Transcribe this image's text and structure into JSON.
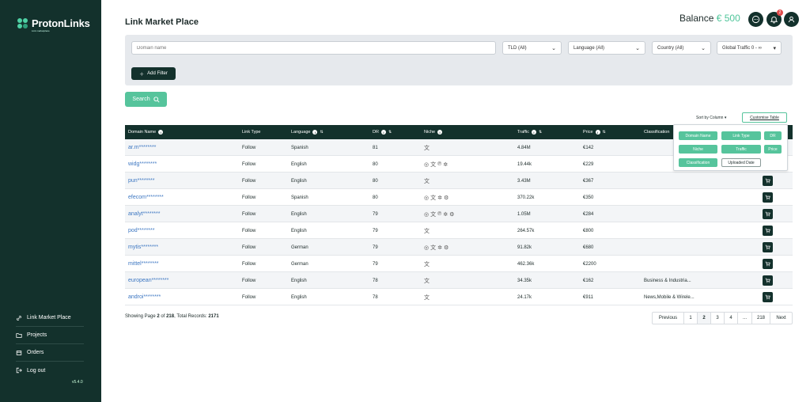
{
  "sidebar": {
    "logo_text": "ProtonLinks",
    "logo_sub": "Link marketplace",
    "items": [
      {
        "label": "Link Market Place",
        "icon": "link-icon"
      },
      {
        "label": "Projects",
        "icon": "folder-icon"
      },
      {
        "label": "Orders",
        "icon": "orders-icon"
      },
      {
        "label": "Log out",
        "icon": "logout-icon"
      }
    ],
    "version": "v5.4.0"
  },
  "header": {
    "title": "Link Market Place",
    "balance_label": "Balance",
    "balance_amount": "€ 500",
    "notification_count": "2"
  },
  "filters": {
    "domain_placeholder": "Domain name",
    "tld": "TLD (All)",
    "language": "Language (All)",
    "country": "Country (All)",
    "traffic": "Global Traffic  0 - ∞",
    "add_filter": "Add Filter",
    "search": "Search"
  },
  "table_controls": {
    "sort_by": "Sort by Column",
    "customise": "Customise Table"
  },
  "columns": {
    "domain": "Domain Name",
    "link_type": "Link Type",
    "language": "Language",
    "dr": "DR",
    "niche": "Niche",
    "traffic": "Traffic",
    "price": "Price",
    "classification": "Classification"
  },
  "rows": [
    {
      "domain": "ar.m********",
      "link_type": "Follow",
      "language": "Spanish",
      "dr": "81",
      "niche": [
        "translate"
      ],
      "traffic": "4.84M",
      "price": "€142",
      "classification": ""
    },
    {
      "domain": "widg********",
      "link_type": "Follow",
      "language": "English",
      "dr": "80",
      "niche": [
        "casino",
        "translate",
        "cbd",
        "sun"
      ],
      "traffic": "19.44k",
      "price": "€229",
      "classification": ""
    },
    {
      "domain": "pun********",
      "link_type": "Follow",
      "language": "English",
      "dr": "80",
      "niche": [
        "translate"
      ],
      "traffic": "3.43M",
      "price": "€367",
      "classification": ""
    },
    {
      "domain": "efecom********",
      "link_type": "Follow",
      "language": "Spanish",
      "dr": "80",
      "niche": [
        "casino",
        "translate",
        "sun",
        "gear"
      ],
      "traffic": "370.22k",
      "price": "€350",
      "classification": ""
    },
    {
      "domain": "analyt********",
      "link_type": "Follow",
      "language": "English",
      "dr": "79",
      "niche": [
        "casino",
        "translate",
        "cbd",
        "sun",
        "gear"
      ],
      "traffic": "1.05M",
      "price": "€284",
      "classification": ""
    },
    {
      "domain": "pod********",
      "link_type": "Follow",
      "language": "English",
      "dr": "79",
      "niche": [
        "translate"
      ],
      "traffic": "264.57k",
      "price": "€800",
      "classification": ""
    },
    {
      "domain": "mytis********",
      "link_type": "Follow",
      "language": "German",
      "dr": "79",
      "niche": [
        "casino",
        "translate",
        "sun",
        "gear"
      ],
      "traffic": "91.82k",
      "price": "€680",
      "classification": ""
    },
    {
      "domain": "mittel********",
      "link_type": "Follow",
      "language": "German",
      "dr": "79",
      "niche": [
        "translate"
      ],
      "traffic": "462.36k",
      "price": "€2200",
      "classification": ""
    },
    {
      "domain": "european********",
      "link_type": "Follow",
      "language": "English",
      "dr": "78",
      "niche": [
        "translate"
      ],
      "traffic": "34.35k",
      "price": "€162",
      "classification": "Business & Industria..."
    },
    {
      "domain": "androi********",
      "link_type": "Follow",
      "language": "English",
      "dr": "78",
      "niche": [
        "translate"
      ],
      "traffic": "24.17k",
      "price": "€911",
      "classification": "News,Mobile & Wirele..."
    }
  ],
  "customise_popup": {
    "chips": [
      {
        "label": "Domain Name",
        "on": true
      },
      {
        "label": "Link Type",
        "on": true
      },
      {
        "label": "DR",
        "on": true
      },
      {
        "label": "Niche",
        "on": true
      },
      {
        "label": "Traffic",
        "on": true
      },
      {
        "label": "Price",
        "on": true
      },
      {
        "label": "Classification",
        "on": true
      },
      {
        "label": "Uploaded Date",
        "on": false
      }
    ]
  },
  "footer": {
    "summary_prefix": "Showing Page",
    "current_page": "2",
    "of": "of",
    "total_pages": "218",
    "records_label": ", Total Records:",
    "total_records": "2171"
  },
  "pagination": [
    "Previous",
    "1",
    "2",
    "3",
    "4",
    "...",
    "218",
    "Next"
  ],
  "colors": {
    "sidebar": "#13312c",
    "accent": "#56c49c",
    "link": "#3d77c2"
  }
}
